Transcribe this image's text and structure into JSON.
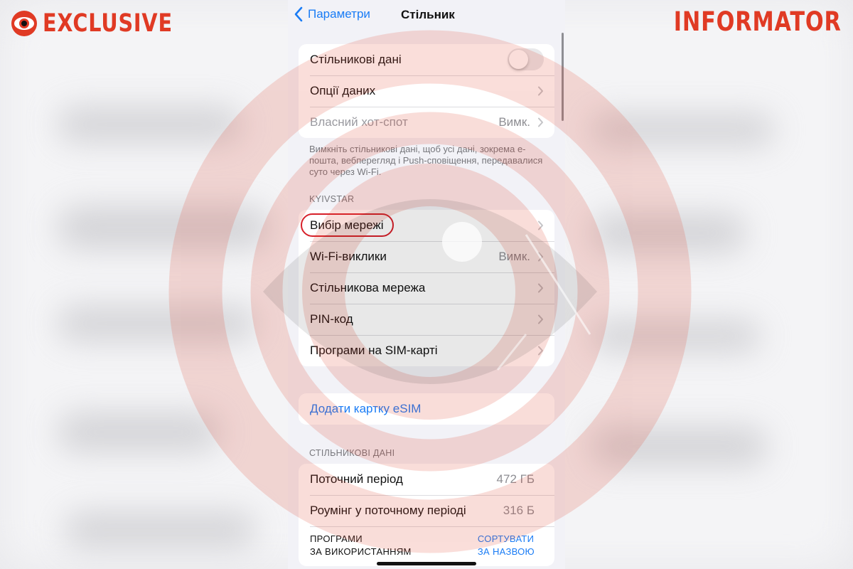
{
  "watermark": {
    "left_logo_text": "EXCLUSIVE",
    "right_logo_text": "INFORMATOR",
    "brand_color": "#e03a24"
  },
  "navbar": {
    "back_label": "Параметри",
    "title": "Стільник"
  },
  "group1": {
    "rows": [
      {
        "label": "Стільникові дані",
        "toggle": false
      },
      {
        "label": "Опції даних"
      },
      {
        "label": "Власний хот-спот",
        "value": "Вимк."
      }
    ],
    "footnote": "Вимкніть стільникові дані, щоб усі дані, зокрема е-пошта, вебперегляд і Push-сповіщення, передавалися суто через Wi-Fi."
  },
  "carrier_header": "KYIVSTAR",
  "group2": {
    "rows": [
      {
        "label": "Вибір мережі"
      },
      {
        "label": "Wi-Fi-виклики",
        "value": "Вимк."
      },
      {
        "label": "Стільникова мережа"
      },
      {
        "label": "PIN-код"
      },
      {
        "label": "Програми на SIM-карті"
      }
    ]
  },
  "esim": {
    "label": "Додати картку eSIM"
  },
  "data_header": "СТІЛЬНИКОВІ ДАНІ",
  "group4": {
    "rows": [
      {
        "label": "Поточний період",
        "value": "472 ГБ"
      },
      {
        "label": "Роумінг у поточному періоді",
        "value": "316 Б"
      }
    ],
    "apps": {
      "left_line1": "ПРОГРАМИ",
      "left_line2": "ЗА ВИКОРИСТАННЯМ",
      "right_line1": "СОРТУВАТИ",
      "right_line2": "ЗА НАЗВОЮ"
    }
  },
  "colors": {
    "accent": "#1a7cf5",
    "highlight_ring": "#d7202a",
    "group_background": "#f2f2f7"
  }
}
